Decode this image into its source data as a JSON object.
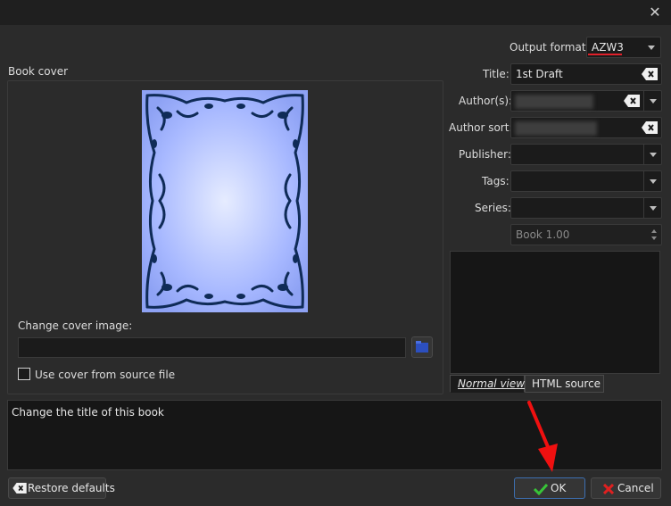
{
  "output_format": {
    "label": "Output format:",
    "value": "AZW3"
  },
  "book_cover": {
    "title": "Book cover",
    "change_cover_label": "Change cover image:",
    "use_source_label": "Use cover from source file",
    "use_source_checked": false
  },
  "metadata": {
    "title_label": "Title:",
    "title_value": "1st Draft",
    "authors_label": "Author(s):",
    "author_sort_label": "Author sort:",
    "publisher_label": "Publisher:",
    "tags_label": "Tags:",
    "series_label": "Series:",
    "series_index": "Book 1.00"
  },
  "comments_tabs": {
    "normal": "Normal view",
    "html": "HTML source"
  },
  "help_text": "Change the title of this book",
  "buttons": {
    "restore": "Restore defaults",
    "ok": "OK",
    "cancel": "Cancel"
  },
  "colors": {
    "accent_underline": "#e0202a",
    "ok_border": "#3d6fb0",
    "arrow": "#f01010"
  }
}
